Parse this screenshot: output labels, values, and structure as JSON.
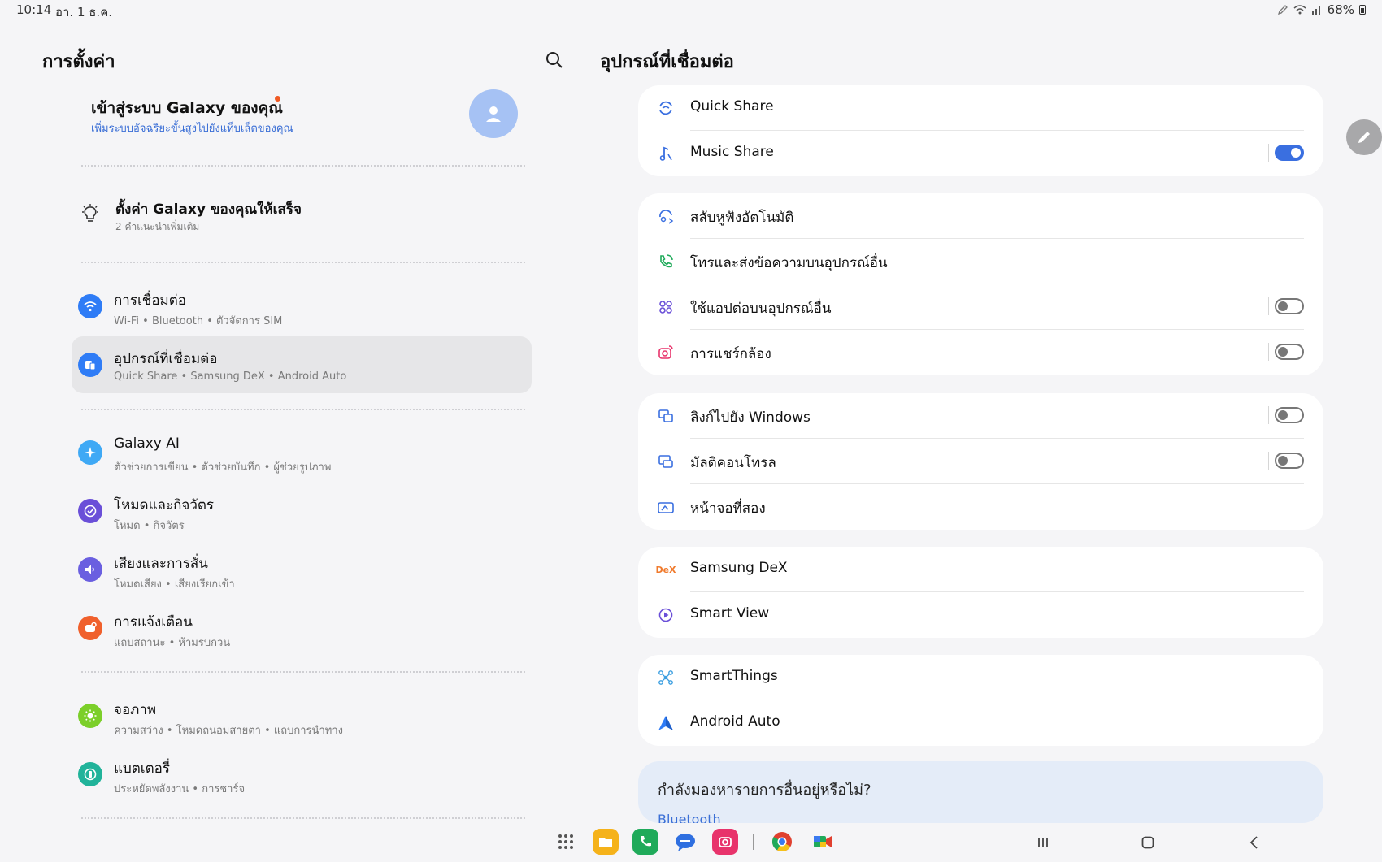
{
  "status_bar": {
    "time": "10:14",
    "date": "อา. 1 ธ.ค.",
    "battery": "68%"
  },
  "left": {
    "title": "การตั้งค่า",
    "profile": {
      "name": "เข้าสู่ระบบ Galaxy ของคุณ",
      "subtitle": "เพิ่มระบบอัจฉริยะขั้นสูงไปยังแท็บเล็ตของคุณ"
    },
    "setup": {
      "title": "ตั้งค่า Galaxy ของคุณให้เสร็จ",
      "subtitle": "2 คำแนะนำเพิ่มเติม"
    },
    "items": [
      {
        "title": "การเชื่อมต่อ",
        "subtitle": "Wi-Fi  •  Bluetooth  •  ตัวจัดการ SIM",
        "icon": "wifi-icon",
        "color": "#2f7cf6"
      },
      {
        "title": "อุปกรณ์ที่เชื่อมต่อ",
        "subtitle": "Quick Share  •  Samsung DeX  •  Android Auto",
        "icon": "connected-devices-icon",
        "color": "#2f7cf6"
      },
      {
        "title": "Galaxy AI",
        "subtitle": "ตัวช่วยการเขียน  •  ตัวช่วยบันทึก  •  ผู้ช่วยรูปภาพ",
        "icon": "sparkle-icon",
        "color": "#3fa9f5"
      },
      {
        "title": "โหมดและกิจวัตร",
        "subtitle": "โหมด  •  กิจวัตร",
        "icon": "check-circle-icon",
        "color": "#6a4fd8"
      },
      {
        "title": "เสียงและการสั่น",
        "subtitle": "โหมดเสียง  •  เสียงเรียกเข้า",
        "icon": "speaker-icon",
        "color": "#6a5fe0"
      },
      {
        "title": "การแจ้งเตือน",
        "subtitle": "แถบสถานะ  •  ห้ามรบกวน",
        "icon": "notification-icon",
        "color": "#f0602c"
      },
      {
        "title": "จอภาพ",
        "subtitle": "ความสว่าง  •  โหมดถนอมสายตา  •  แถบการนำทาง",
        "icon": "sun-icon",
        "color": "#7ccf2a"
      },
      {
        "title": "แบตเตอรี่",
        "subtitle": "ประหยัดพลังงาน  •  การชาร์จ",
        "icon": "battery-icon",
        "color": "#21b39a"
      }
    ]
  },
  "right": {
    "title": "อุปกรณ์ที่เชื่อมต่อ",
    "groups": [
      [
        {
          "label": "Quick Share",
          "icon": "quick-share-icon"
        },
        {
          "label": "Music Share",
          "icon": "music-share-icon",
          "toggle": true
        }
      ],
      [
        {
          "label": "สลับหูฟังอัตโนมัติ",
          "icon": "earbuds-switch-icon"
        },
        {
          "label": "โทรและส่งข้อความบนอุปกรณ์อื่น",
          "icon": "call-icon"
        },
        {
          "label": "ใช้แอปต่อบนอุปกรณ์อื่น",
          "icon": "apps-continuity-icon",
          "toggle": false
        },
        {
          "label": "การแชร์กล้อง",
          "icon": "camera-share-icon",
          "toggle": false
        }
      ],
      [
        {
          "label": "ลิงก์ไปยัง Windows",
          "icon": "link-windows-icon",
          "toggle": false
        },
        {
          "label": "มัลติคอนโทรล",
          "icon": "multi-control-icon",
          "toggle": false
        },
        {
          "label": "หน้าจอที่สอง",
          "icon": "second-screen-icon"
        }
      ],
      [
        {
          "label": "Samsung DeX",
          "icon": "dex-icon"
        },
        {
          "label": "Smart View",
          "icon": "smart-view-icon"
        }
      ],
      [
        {
          "label": "SmartThings",
          "icon": "smartthings-icon"
        },
        {
          "label": "Android Auto",
          "icon": "android-auto-icon"
        }
      ]
    ],
    "looking": {
      "question": "กำลังมองหารายการอื่นอยู่หรือไม่?",
      "link": "Bluetooth"
    }
  },
  "dock": [
    {
      "name": "app-drawer-icon"
    },
    {
      "name": "my-files-icon",
      "color": "#f5b21a"
    },
    {
      "name": "phone-icon",
      "color": "#1faa5a"
    },
    {
      "name": "messages-icon",
      "color": "#2f6fe0"
    },
    {
      "name": "camera-app-icon",
      "color": "#e8336b"
    },
    {
      "name": "chrome-icon"
    },
    {
      "name": "meet-icon"
    }
  ]
}
